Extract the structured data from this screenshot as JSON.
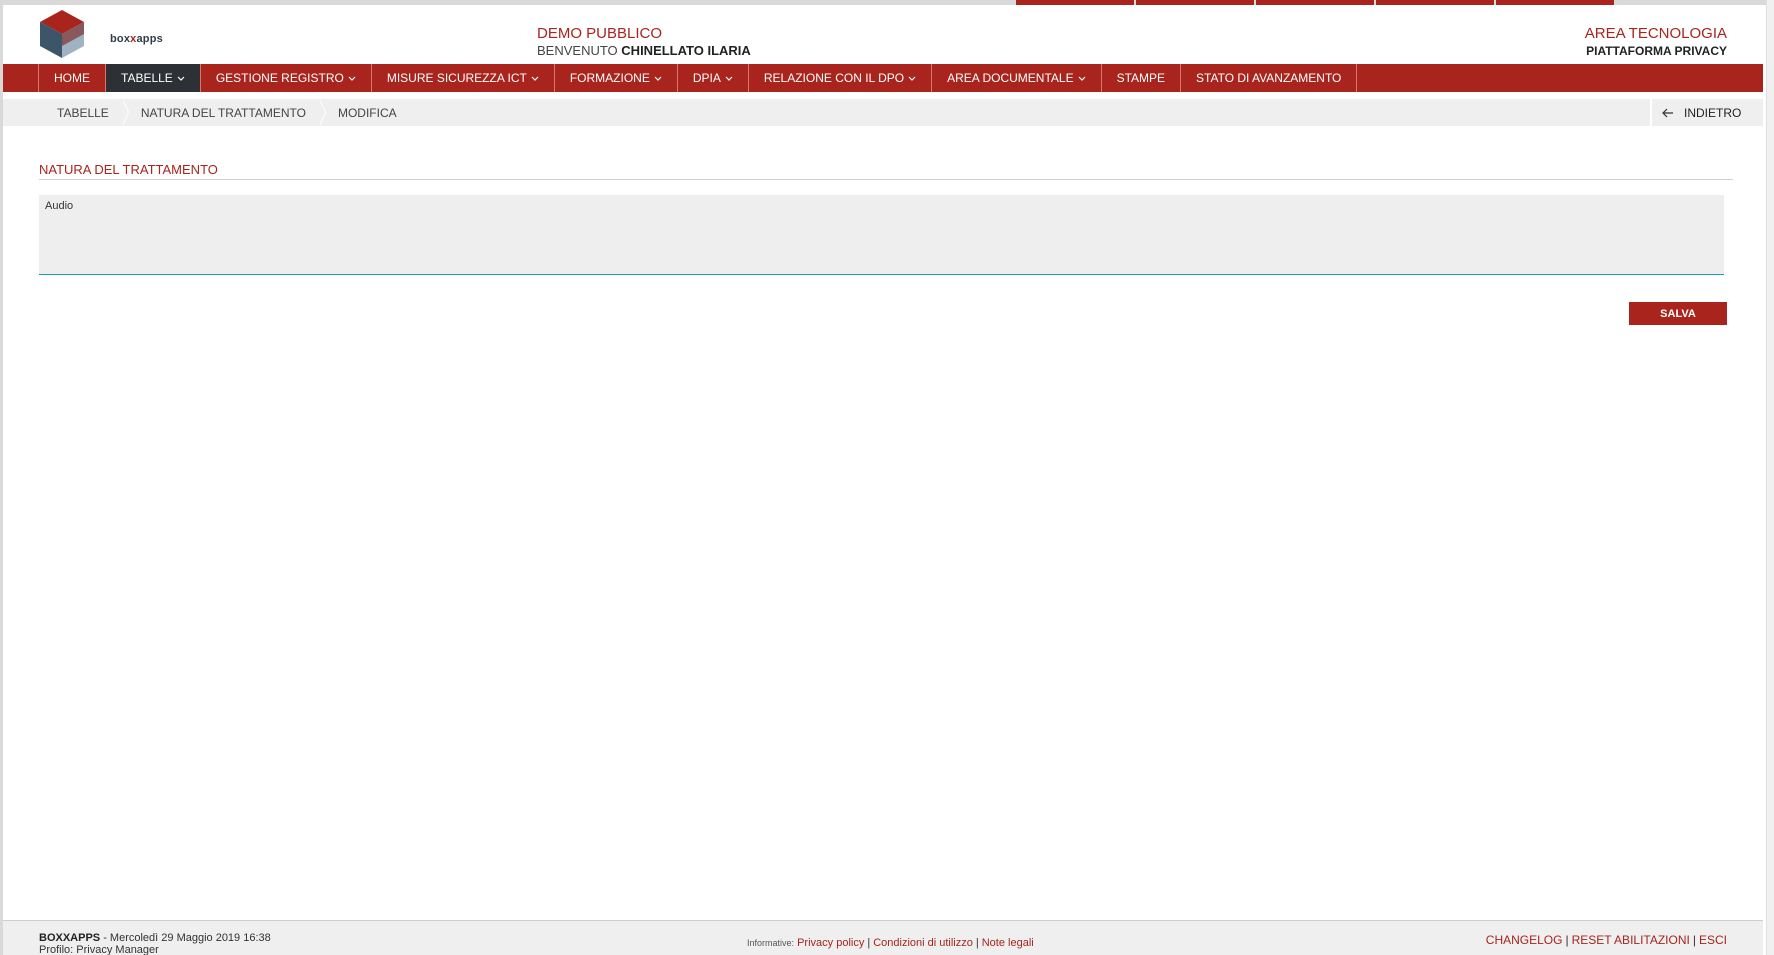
{
  "header": {
    "logo_text_a": "box",
    "logo_text_b": "x",
    "logo_text_c": "apps",
    "demo": "DEMO PUBBLICO",
    "welcome_prefix": "BENVENUTO",
    "welcome_user": "CHINELLATO ILARIA",
    "area": "AREA TECNOLOGIA",
    "platform": "PIATTAFORMA PRIVACY"
  },
  "nav": {
    "items": [
      {
        "label": "HOME",
        "dropdown": false,
        "active": false
      },
      {
        "label": "TABELLE",
        "dropdown": true,
        "active": true
      },
      {
        "label": "GESTIONE REGISTRO",
        "dropdown": true,
        "active": false
      },
      {
        "label": "MISURE SICUREZZA ICT",
        "dropdown": true,
        "active": false
      },
      {
        "label": "FORMAZIONE",
        "dropdown": true,
        "active": false
      },
      {
        "label": "DPIA",
        "dropdown": true,
        "active": false
      },
      {
        "label": "RELAZIONE CON IL DPO",
        "dropdown": true,
        "active": false
      },
      {
        "label": "AREA DOCUMENTALE",
        "dropdown": true,
        "active": false
      },
      {
        "label": "STAMPE",
        "dropdown": false,
        "active": false
      },
      {
        "label": "STATO DI AVANZAMENTO",
        "dropdown": false,
        "active": false
      }
    ]
  },
  "breadcrumb": {
    "items": [
      "TABELLE",
      "NATURA DEL TRATTAMENTO",
      "MODIFICA"
    ],
    "back_label": "INDIETRO"
  },
  "form": {
    "section_title": "NATURA DEL TRATTAMENTO",
    "value": "Audio",
    "save_label": "SALVA"
  },
  "footer": {
    "brand": "BOXXAPPS",
    "datetime": "- Mercoledì 29 Maggio 2019 16:38",
    "profile": "Profilo: Privacy Manager",
    "informative_label": "Informative:",
    "privacy_policy": "Privacy policy",
    "terms": "Condizioni di utilizzo",
    "legal": "Note legali",
    "changelog": "CHANGELOG",
    "reset": "RESET ABILITAZIONI",
    "exit": "ESCI"
  },
  "colors": {
    "accent": "#a8241c",
    "nav_active": "#2d3135",
    "field_underline": "#17a2b0"
  }
}
